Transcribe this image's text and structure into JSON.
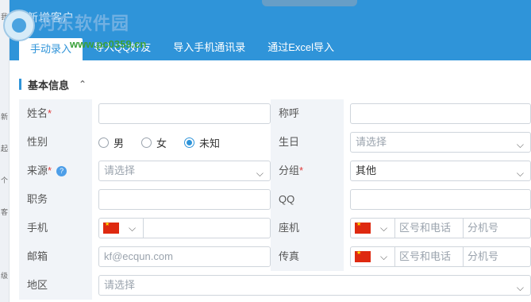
{
  "background_strip_chars": [
    "我",
    "新",
    "起",
    "个",
    "客",
    "级"
  ],
  "watermark": {
    "brand": "河东软件园",
    "url": "www.pc0359.cn"
  },
  "dialog": {
    "title": "新增客户"
  },
  "tabs": [
    {
      "label": "手动录入",
      "active": true
    },
    {
      "label": "导入QQ好友"
    },
    {
      "label": "导入手机通讯录"
    },
    {
      "label": "通过Excel导入"
    }
  ],
  "section": {
    "title": "基本信息",
    "toggle": "⌃"
  },
  "form": {
    "name": {
      "label": "姓名",
      "required": "*",
      "value": ""
    },
    "title_call": {
      "label": "称呼",
      "value": ""
    },
    "gender": {
      "label": "性别",
      "options": [
        "男",
        "女",
        "未知"
      ],
      "selected": "未知"
    },
    "birthday": {
      "label": "生日",
      "placeholder": "请选择"
    },
    "source": {
      "label": "来源",
      "required": "*",
      "help": "?",
      "placeholder": "请选择"
    },
    "group": {
      "label": "分组",
      "required": "*",
      "value": "其他"
    },
    "position": {
      "label": "职务",
      "value": ""
    },
    "qq": {
      "label": "QQ",
      "value": ""
    },
    "mobile": {
      "label": "手机",
      "country": "CN"
    },
    "landline": {
      "label": "座机",
      "area_placeholder": "区号和电话",
      "ext_placeholder": "分机号"
    },
    "email": {
      "label": "邮箱",
      "placeholder": "kf@ecqun.com"
    },
    "fax": {
      "label": "传真",
      "area_placeholder": "区号和电话",
      "ext_placeholder": "分机号"
    },
    "region": {
      "label": "地区",
      "placeholder": "请选择"
    }
  },
  "icons": {
    "chevron": "chevron-down-icon",
    "flag": "china-flag-icon",
    "help": "help-icon"
  },
  "colors": {
    "accent": "#2f94d9",
    "required": "#e03b3b",
    "label_bg": "#f1f4f8"
  }
}
